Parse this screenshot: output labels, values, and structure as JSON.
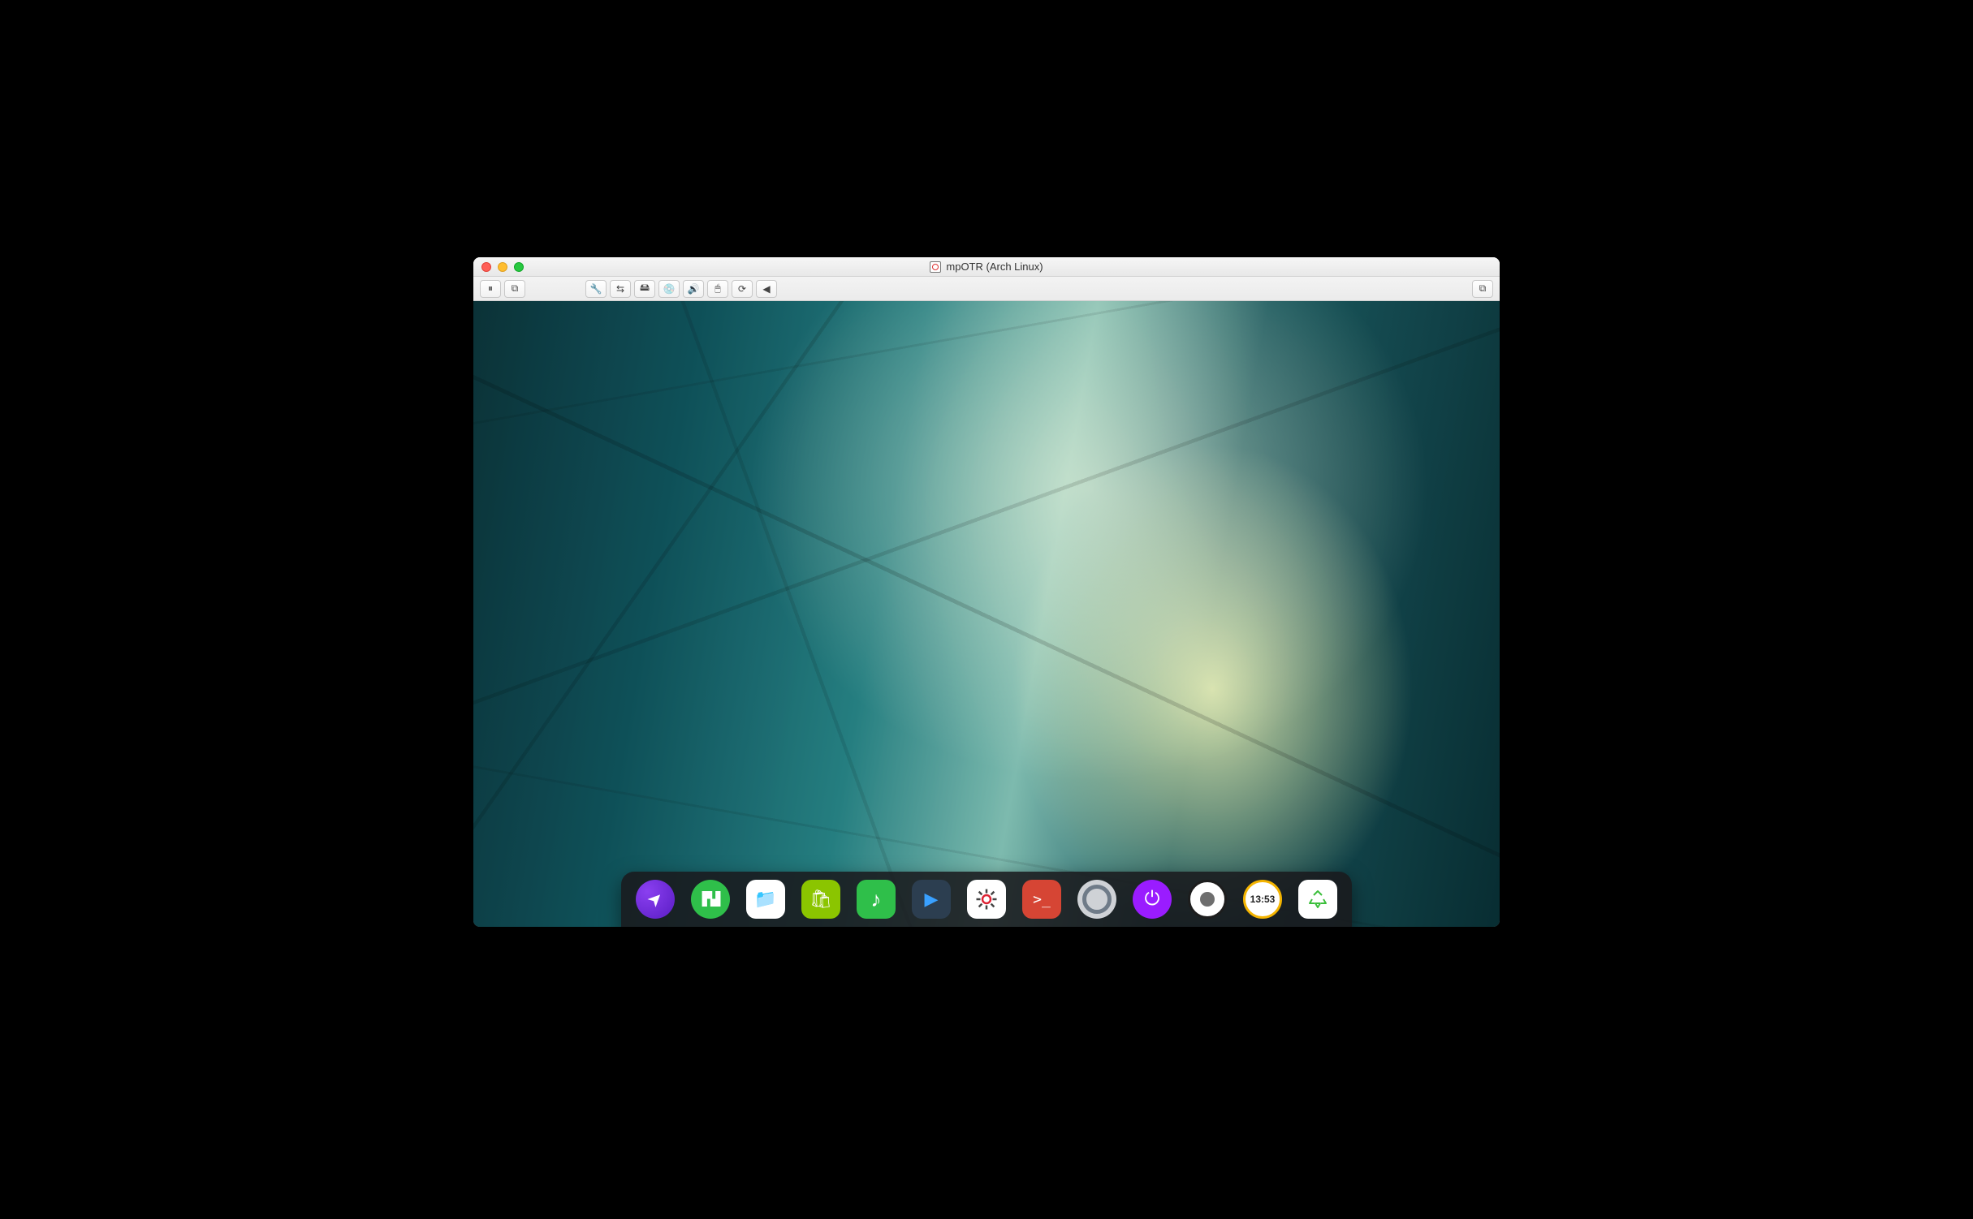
{
  "host_window": {
    "title": "mpOTR (Arch Linux)",
    "traffic_lights": {
      "close": "close",
      "minimize": "minimize",
      "zoom": "zoom"
    },
    "toolbar": {
      "left_group": [
        {
          "name": "pause-button",
          "glyph": "⏸"
        },
        {
          "name": "snapshot-button",
          "glyph": "⧉"
        }
      ],
      "machine_group": [
        {
          "name": "settings-button",
          "glyph": "🔧"
        },
        {
          "name": "network-button",
          "glyph": "⇆"
        },
        {
          "name": "harddisk-button",
          "glyph": "🖴"
        },
        {
          "name": "optical-button",
          "glyph": "💿"
        },
        {
          "name": "audio-button",
          "glyph": "🔊"
        },
        {
          "name": "usb-button",
          "glyph": "🖱"
        },
        {
          "name": "shared-folders-button",
          "glyph": "⟳"
        },
        {
          "name": "collapse-button",
          "glyph": "◀"
        }
      ],
      "right_group": [
        {
          "name": "fullscreen-button",
          "glyph": "⧉"
        }
      ]
    }
  },
  "guest_desktop": {
    "wallpaper_desc": "teal architectural curves",
    "dock": {
      "items": [
        {
          "name": "launcher",
          "label": "Launcher",
          "style": "rocket round"
        },
        {
          "name": "multitask",
          "label": "Multitask View",
          "style": "workspace round"
        },
        {
          "name": "file-manager",
          "label": "File Manager",
          "style": "files"
        },
        {
          "name": "app-store",
          "label": "App Store",
          "style": "store"
        },
        {
          "name": "music",
          "label": "Music",
          "style": "music"
        },
        {
          "name": "video",
          "label": "Movie",
          "style": "video"
        },
        {
          "name": "settings",
          "label": "Control Center",
          "style": "settings"
        },
        {
          "name": "terminal",
          "label": "Terminal",
          "style": "terminal"
        },
        {
          "name": "browser",
          "label": "Browser",
          "style": "browser"
        },
        {
          "name": "power",
          "label": "Shutdown",
          "style": "power round"
        },
        {
          "name": "eye",
          "label": "System Monitor",
          "style": "eye round"
        },
        {
          "name": "clock",
          "label": "Clock",
          "style": "clock round",
          "text": "13:53"
        },
        {
          "name": "trash",
          "label": "Trash",
          "style": "trash"
        }
      ]
    }
  }
}
